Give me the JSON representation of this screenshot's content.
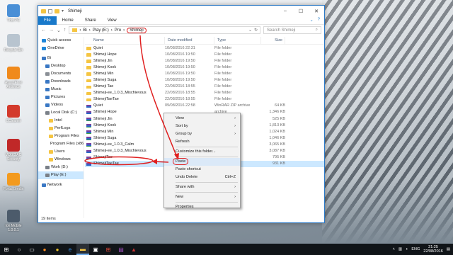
{
  "window": {
    "title": "Shimeji",
    "qat_glyph": "▾"
  },
  "ribbon": {
    "tabs": [
      "File",
      "Home",
      "Share",
      "View"
    ]
  },
  "address": {
    "crumbs": [
      "Bi",
      "Play (E:)",
      "Pro"
    ],
    "current": "Shimeji",
    "search_placeholder": "Search Shimeji"
  },
  "columns": [
    "Name",
    "Date modified",
    "Type",
    "Size"
  ],
  "navpane": [
    {
      "label": "Quick access",
      "color": "#1e86d9",
      "indent": 1
    },
    {
      "label": "OneDrive",
      "color": "#1e86d9",
      "indent": 1
    },
    {
      "label": "Bi",
      "color": "#3a78c4",
      "indent": 1
    },
    {
      "label": "Desktop",
      "color": "#3a78c4",
      "indent": 2
    },
    {
      "label": "Documents",
      "color": "#8a8f96",
      "indent": 2
    },
    {
      "label": "Downloads",
      "color": "#3a78c4",
      "indent": 2
    },
    {
      "label": "Music",
      "color": "#3a78c4",
      "indent": 2
    },
    {
      "label": "Pictures",
      "color": "#3a78c4",
      "indent": 2
    },
    {
      "label": "Videos",
      "color": "#3a78c4",
      "indent": 2
    },
    {
      "label": "Local Disk (C:)",
      "color": "#7a8088",
      "indent": 2
    },
    {
      "label": "Intel",
      "color": "#f5c542",
      "indent": 3
    },
    {
      "label": "PerfLogs",
      "color": "#f5c542",
      "indent": 3
    },
    {
      "label": "Program Files",
      "color": "#f5c542",
      "indent": 3
    },
    {
      "label": "Program Files (x86",
      "color": "#f5c542",
      "indent": 3
    },
    {
      "label": "Users",
      "color": "#f5c542",
      "indent": 3
    },
    {
      "label": "Windows",
      "color": "#f5c542",
      "indent": 3
    },
    {
      "label": "Work (D:)",
      "color": "#7a8088",
      "indent": 2
    },
    {
      "label": "Play (E:)",
      "color": "#7a8088",
      "indent": 2,
      "selected": true
    },
    {
      "label": "Network",
      "color": "#3a78c4",
      "indent": 1
    }
  ],
  "files": [
    {
      "name": "Quiet",
      "date": "10/08/2016 22:31",
      "type": "File folder",
      "size": "",
      "icon": "folder"
    },
    {
      "name": "Shimeji Hope",
      "date": "10/08/2016 19:50",
      "type": "File folder",
      "size": "",
      "icon": "folder"
    },
    {
      "name": "Shimeji Jin",
      "date": "10/08/2016 19:50",
      "type": "File folder",
      "size": "",
      "icon": "folder"
    },
    {
      "name": "Shimeji Kook",
      "date": "10/08/2016 19:50",
      "type": "File folder",
      "size": "",
      "icon": "folder"
    },
    {
      "name": "Shimeji Min",
      "date": "10/08/2016 19:50",
      "type": "File folder",
      "size": "",
      "icon": "folder"
    },
    {
      "name": "Shimeji Suga",
      "date": "10/08/2016 19:50",
      "type": "File folder",
      "size": "",
      "icon": "folder"
    },
    {
      "name": "Shimeji Tae",
      "date": "22/08/2016 18:55",
      "type": "File folder",
      "size": "",
      "icon": "folder"
    },
    {
      "name": "Shimeji-ee_1.0.3_Mischievous",
      "date": "22/08/2016 18:55",
      "type": "File folder",
      "size": "",
      "icon": "folder"
    },
    {
      "name": "ShimejiTaeTae",
      "date": "22/08/2016 18:55",
      "type": "File folder",
      "size": "",
      "icon": "folder"
    },
    {
      "name": "Quiet",
      "date": "09/08/2016 22:58",
      "type": "WinRAR ZIP archive",
      "size": "64 KB",
      "icon": "rar"
    },
    {
      "name": "Shimeji Hope",
      "date": "",
      "type": "archive",
      "size": "1,346 KB",
      "icon": "rar"
    },
    {
      "name": "Shimeji Jin",
      "date": "",
      "type": "archive",
      "size": "525 KB",
      "icon": "rar"
    },
    {
      "name": "Shimeji Kook",
      "date": "",
      "type": "archive",
      "size": "1,813 KB",
      "icon": "rar"
    },
    {
      "name": "Shimeji Min",
      "date": "",
      "type": "archive",
      "size": "1,024 KB",
      "icon": "rar"
    },
    {
      "name": "Shimeji Suga",
      "date": "",
      "type": "archive",
      "size": "1,046 KB",
      "icon": "rar"
    },
    {
      "name": "Shimeji-ee_1.0.3_Calm",
      "date": "",
      "type": "archive",
      "size": "3,065 KB",
      "icon": "rar"
    },
    {
      "name": "Shimeji-ee_1.0.3_Mischievous",
      "date": "",
      "type": "archive",
      "size": "3,087 KB",
      "icon": "rar"
    },
    {
      "name": "ShimejiTae",
      "date": "",
      "type": "archive",
      "size": "795 KB",
      "icon": "rar"
    },
    {
      "name": "ShimejiTaeTae",
      "date": "",
      "type": "archive",
      "size": "931 KB",
      "icon": "rar",
      "selected": true
    }
  ],
  "status": "19 items",
  "context_menu": [
    {
      "label": "View",
      "sub": true
    },
    {
      "label": "Sort by",
      "sub": true
    },
    {
      "label": "Group by",
      "sub": true
    },
    {
      "label": "Refresh"
    },
    {
      "sep": true
    },
    {
      "label": "Customize this folder..."
    },
    {
      "sep": true
    },
    {
      "label": "Paste",
      "highlight": true
    },
    {
      "label": "Paste shortcut"
    },
    {
      "label": "Undo Delete",
      "shortcut": "Ctrl+Z"
    },
    {
      "sep": true
    },
    {
      "label": "Share with",
      "sub": true
    },
    {
      "sep": true
    },
    {
      "label": "New",
      "sub": true
    },
    {
      "sep": true
    },
    {
      "label": "Properties"
    }
  ],
  "desktop_icons": [
    {
      "label": "This PC",
      "color": "#4a8fd6"
    },
    {
      "label": "Recycle Bin",
      "color": "#b8c4cf"
    },
    {
      "label": "Avast Free Antivirus",
      "color": "#f08a1c"
    },
    {
      "label": "CCleaner",
      "color": "#d33a2c"
    },
    {
      "label": "VOBCIAC Security",
      "color": "#c02828"
    },
    {
      "label": "Portal Bredin",
      "color": "#f39a1e"
    },
    {
      "label": "Ion Mobile 1.0.0.1",
      "color": "#4c5b6b"
    }
  ],
  "taskbar": {
    "time": "21:25",
    "date": "22/08/2016",
    "lang": "ENG"
  }
}
